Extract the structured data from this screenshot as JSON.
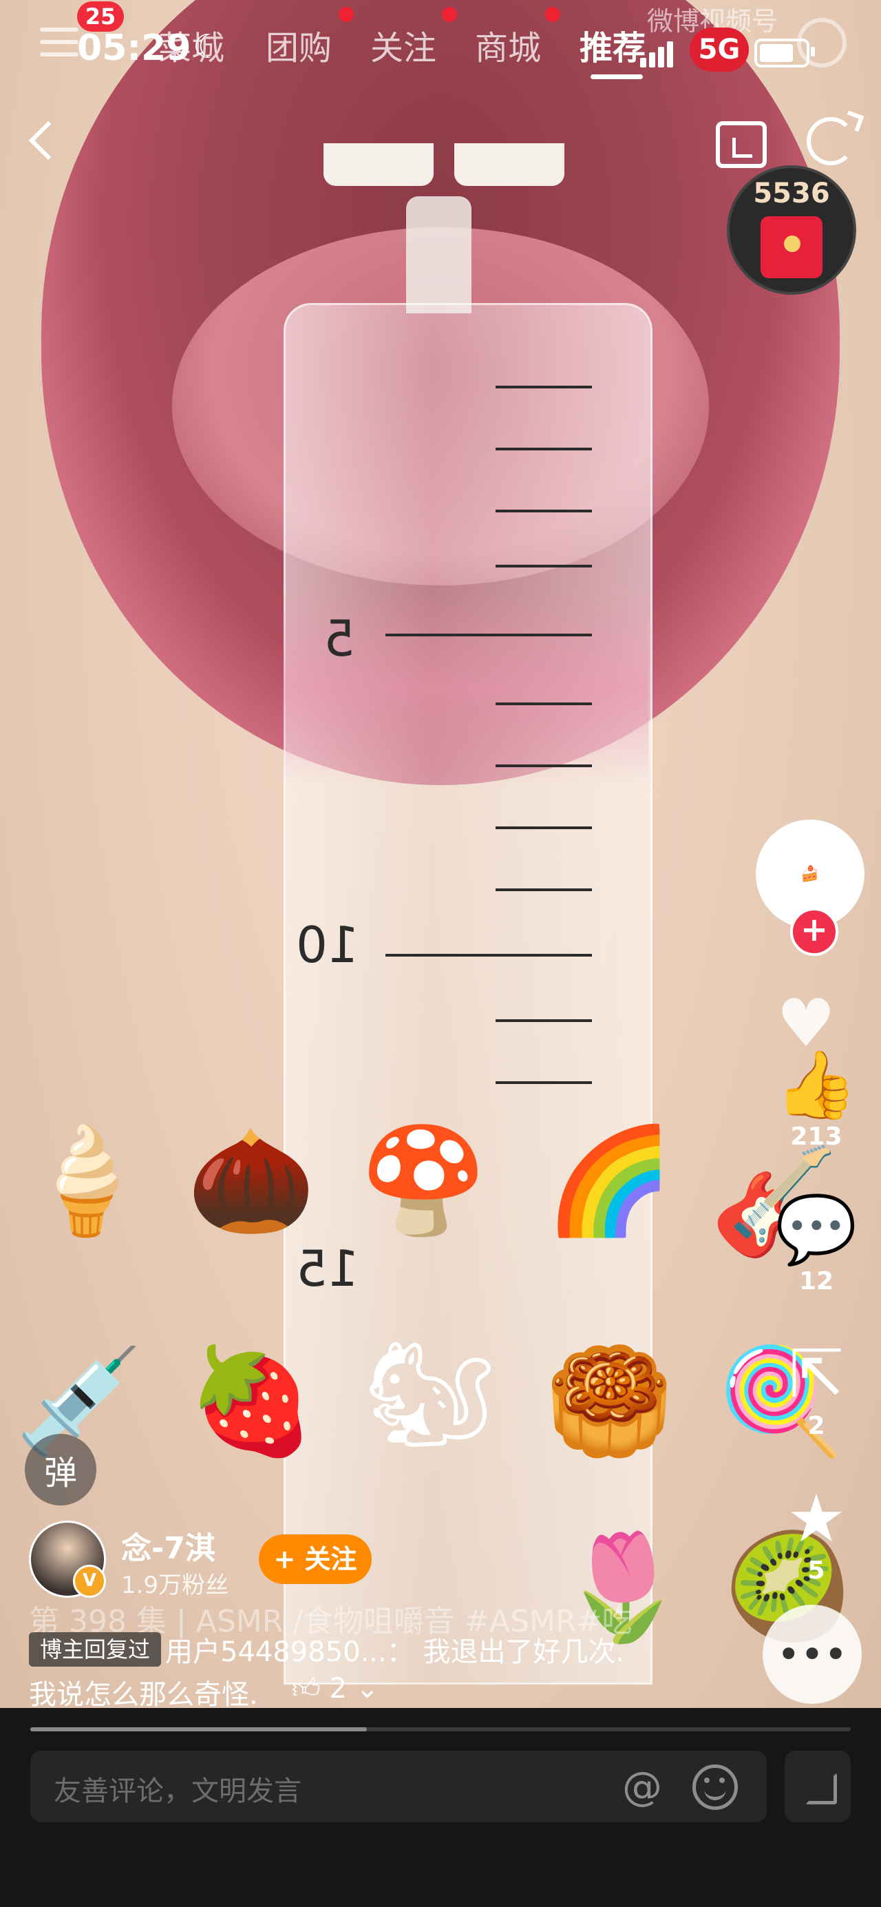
{
  "status_bar": {
    "time": "05:29",
    "network": "5G",
    "notification_count": "25"
  },
  "nav": {
    "tabs": [
      {
        "label": "菜城"
      },
      {
        "label": "团购"
      },
      {
        "label": "关注"
      },
      {
        "label": "商城"
      },
      {
        "label": "推荐",
        "active": true
      }
    ],
    "watermark": "微博视频号"
  },
  "red_packet": {
    "count": "5536"
  },
  "video": {
    "syringe_marks": [
      "5",
      "10",
      "15"
    ],
    "stickers": [
      "ice-cream",
      "chestnut",
      "mushroom",
      "rainbow",
      "guitar",
      "syringe",
      "strawberry",
      "chipmunk",
      "mooncake",
      "lollipop",
      "tulip",
      "kiwi"
    ]
  },
  "rail": {
    "like_count": "213",
    "comment_count": "12",
    "share_count": "2",
    "favorite_count": "5"
  },
  "author": {
    "name": "念-7淇",
    "fans": "1.9万粉丝",
    "follow_label": "+ 关注"
  },
  "caption": {
    "ghost_text": "第 398 集 | ASMR /食物咀嚼音 #ASMR#吃"
  },
  "reply": {
    "tag": "博主回复过",
    "line1": "用户54489850...： 我退出了好几次.",
    "line2": "我说怎么那么奇怪.",
    "likes": "2"
  },
  "danmu": {
    "label": "弹"
  },
  "comment_bar": {
    "placeholder": "友善评论，文明发言"
  },
  "playback": {
    "progress": 0.41
  }
}
